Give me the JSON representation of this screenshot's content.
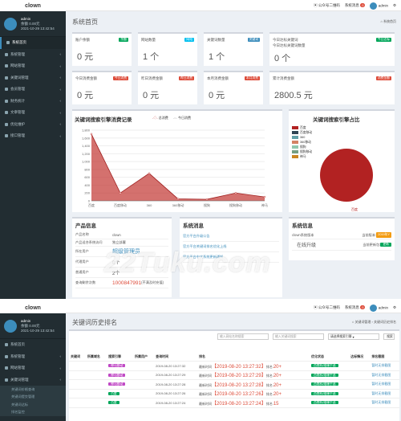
{
  "app": {
    "logo": "clown"
  },
  "topbar": {
    "qr": "公众号二维码",
    "msg": "系统消息",
    "msg_count": "0",
    "user": "admin"
  },
  "user": {
    "name": "admin",
    "balance": "余额 0.00元",
    "time1": "2021-10-29 13:42:54",
    "time2": "2021-10-29 13:42:54"
  },
  "menu": [
    "系统首页",
    "系统管理",
    "网站管理",
    "关键词管理",
    "会员管理",
    "财务统计",
    "文章管理",
    "优化维护",
    "接口管理"
  ],
  "menu2": [
    "系统首页",
    "系统管理",
    "网站管理",
    "关键词管理"
  ],
  "submenu": [
    "关键词价格查询",
    "关键词提交管理",
    "关键词达标",
    "排名监控"
  ],
  "dash": {
    "title": "系统首页",
    "crumb": "系统首页",
    "cards": [
      {
        "label": "账户余额",
        "tag": "余额",
        "value": "0 元",
        "color": "#00a65a"
      },
      {
        "label": "网站数量",
        "tag": "网站",
        "value": "1 个",
        "color": "#00c0ef"
      },
      {
        "label": "关键词数量",
        "tag": "关键词",
        "value": "1 个",
        "color": "#3c8dbc"
      },
      {
        "label": "今日达标关键词",
        "label2": "今日达标关键词数量",
        "tag": "今日达标",
        "value": "0 个",
        "color": "#00a65a"
      },
      {
        "label": "今日消费金额",
        "tag": "今日消费",
        "value": "0 元",
        "color": "#dd4b39"
      },
      {
        "label": "昨日消费金额",
        "tag": "昨日消费",
        "value": "0 元",
        "color": "#dd4b39"
      },
      {
        "label": "本月消费金额",
        "tag": "本月消费",
        "value": "0 元",
        "color": "#dd4b39"
      },
      {
        "label": "累计消费金额",
        "tag": "消费金额",
        "value": "2800.5 元",
        "color": "#dd4b39"
      }
    ],
    "chart_title": "关键词搜索引擎消费记录",
    "pie_title": "关键词搜索引擎占比",
    "pie_legend": [
      "百度",
      "百度移动",
      "360",
      "360移动",
      "搜狗",
      "搜狗移动",
      "神马"
    ],
    "pie_label": "百度",
    "prod_title": "产品信息",
    "prod": [
      [
        "产品名称",
        "clown"
      ],
      [
        "产品适合系统访问",
        "独立部署"
      ],
      [
        "所在用户",
        "超级管理员"
      ],
      [
        "代理用户",
        "0个"
      ],
      [
        "普通用户",
        "2个"
      ],
      [
        "查询剩余次数",
        "1000847991"
      ]
    ],
    "prod_note": "(不满及时充值)",
    "sys_title": "系统消息",
    "sys_msgs": [
      "官方平台升级公告",
      "官方平台关键词排名优化上线",
      "官方平台中文系统更新通知"
    ],
    "info_title": "系统信息",
    "info": [
      [
        "clown系统版本",
        "当前版本:",
        "2019年Y"
      ],
      [
        "在线升级",
        "当前更新包:",
        "更新"
      ]
    ]
  },
  "chart_data": {
    "type": "area",
    "title": "关键词搜索引擎消费记录",
    "categories": [
      "百度",
      "百度移动",
      "360",
      "360移动",
      "搜狗",
      "搜狗移动",
      "神马"
    ],
    "series": [
      {
        "name": "总消费",
        "values": [
          1700,
          200,
          700,
          50,
          40,
          200,
          100
        ]
      },
      {
        "name": "今日消费",
        "values": [
          0,
          0,
          0,
          0,
          0,
          0,
          0
        ]
      }
    ],
    "y_ticks": [
      "1,800",
      "1,600",
      "1,400",
      "1,200",
      "1,000",
      "800",
      "600",
      "400",
      "200",
      "0"
    ],
    "ylim": [
      0,
      1800
    ]
  },
  "pie_data": {
    "type": "pie",
    "categories": [
      "百度",
      "百度移动",
      "360",
      "360移动",
      "搜狗",
      "搜狗移动",
      "神马"
    ],
    "values": [
      100,
      0,
      0,
      0,
      0,
      0,
      0
    ],
    "colors": [
      "#b22222",
      "#2f4554",
      "#61a0a8",
      "#d48265",
      "#91c7ae",
      "#749f83",
      "#ca8622"
    ]
  },
  "rank": {
    "title": "关键词历史排名",
    "crumb": "关键词管理",
    "crumb2": "关键词历史排名",
    "ph_site": "输入网站名称搜索",
    "ph_kw": "输入关键词搜索",
    "select": "请选择搜索引擎",
    "search_btn": "搜索",
    "headers": [
      "关键词",
      "所属域名",
      "搜索引擎",
      "所属用户",
      "查询时间",
      "排名",
      "优化状态",
      "达标情况",
      "排名截图"
    ],
    "rows": [
      {
        "engine": "神马移动",
        "time": "2019-08-20 13:27:32",
        "rank": "【2019-08-20 13:27:32】",
        "pos": "20+",
        "status": "优化中",
        "etype": "p"
      },
      {
        "engine": "神马移动",
        "time": "2019-08-20 13:27:29",
        "rank": "【2019-08-20 13:27:29】",
        "pos": "20+",
        "status": "优化中",
        "etype": "p"
      },
      {
        "engine": "神马移动",
        "time": "2019-08-20 13:27:28",
        "rank": "【2019-08-20 13:27:28】",
        "pos": "20+",
        "status": "优化中",
        "etype": "p"
      },
      {
        "engine": "百度",
        "time": "2019-08-20 13:27:26",
        "rank": "【2019-08-20 13:27:26】",
        "pos": "20+",
        "status": "优化中",
        "etype": "g"
      },
      {
        "engine": "百度",
        "time": "2019-08-20 13:27:24",
        "rank": "【2019-08-20 13:27:24】",
        "pos": "15",
        "status": "优化中",
        "etype": "g"
      }
    ],
    "rank_prefix": "最新时间",
    "rank_mid": "排名:",
    "btn_text": "西南科/维稀手选",
    "link_text": "暂时无排截图"
  },
  "watermark": "22Tuku.com"
}
